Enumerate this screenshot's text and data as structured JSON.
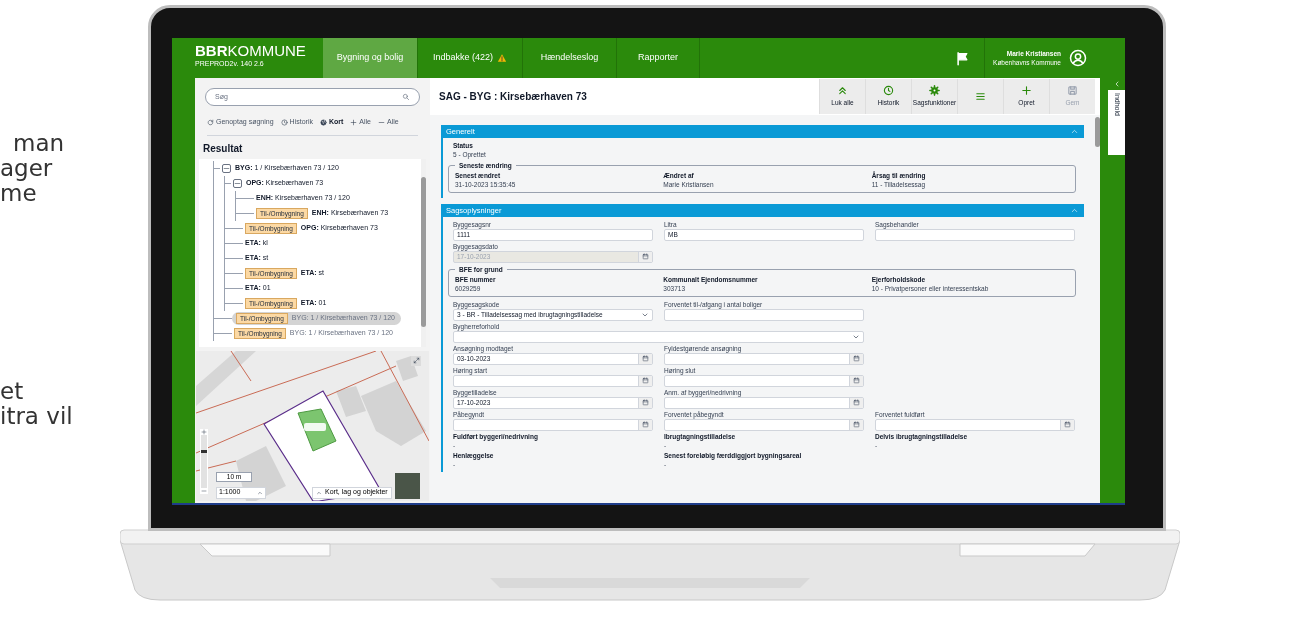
{
  "background_text": [
    "man",
    "ager",
    "me",
    "et",
    "itra vil"
  ],
  "header": {
    "logo_bold": "BBR",
    "logo_light": "KOMMUNE",
    "version": "PREPROD2v. 140 2.6",
    "tabs": [
      {
        "label": "Bygning og bolig",
        "selected": true,
        "warning": false
      },
      {
        "label": "Indbakke (422)",
        "selected": false,
        "warning": true
      },
      {
        "label": "Hændelseslog",
        "selected": false,
        "warning": false
      },
      {
        "label": "Rapporter",
        "selected": false,
        "warning": false
      }
    ],
    "user": {
      "name": "Marie Kristiansen",
      "org": "Københavns Kommune"
    }
  },
  "search": {
    "placeholder": "Søg"
  },
  "search_tools": [
    {
      "label": "Genoptag søgning",
      "kind": "refresh",
      "selected": false
    },
    {
      "label": "Historik",
      "kind": "clock",
      "selected": false
    },
    {
      "label": "Kort",
      "kind": "globe",
      "selected": true
    },
    {
      "label": "Alle",
      "kind": "plus",
      "selected": false
    },
    {
      "label": "Alle",
      "kind": "minus",
      "selected": false
    }
  ],
  "results": {
    "title": "Resultat",
    "tree": [
      {
        "text": "**BYG:** 1 / Kirsebærhaven 73 / 120",
        "expanded": true,
        "selected": false,
        "inactive": false,
        "children": [
          {
            "text": "**OPG:** Kirsebærhaven 73",
            "expanded": true,
            "selected": false,
            "inactive": false,
            "children": [
              {
                "text": "**ENH:** Kirsebærhaven 73 / 120",
                "selected": false,
                "inactive": false
              },
              {
                "badge": "Til-/Ombygning",
                "text": "**ENH:** Kirsebærhaven 73",
                "selected": false,
                "inactive": false
              }
            ]
          },
          {
            "badge": "Til-/Ombygning",
            "text": "**OPG:** Kirsebærhaven 73",
            "selected": false,
            "inactive": false
          },
          {
            "text": "**ETA:** kl",
            "selected": false,
            "inactive": false
          },
          {
            "text": "**ETA:** st",
            "selected": false,
            "inactive": false
          },
          {
            "badge": "Til-/Ombygning",
            "text": "**ETA:** st",
            "selected": false,
            "inactive": false
          },
          {
            "text": "**ETA:** 01",
            "selected": false,
            "inactive": false
          },
          {
            "badge": "Til-/Ombygning",
            "text": "**ETA:** 01",
            "selected": false,
            "inactive": false
          }
        ]
      },
      {
        "badge": "Til-/Ombygning",
        "text": "BYG: 1 / Kirsebærhaven 73 / 120",
        "selected": true,
        "inactive": true
      },
      {
        "badge": "Til-/Ombygning",
        "text": "BYG: 1 / Kirsebærhaven 73 / 120",
        "selected": false,
        "inactive": true
      }
    ]
  },
  "map": {
    "zoom": {
      "level": 0.65
    },
    "scale_bar": "10 m",
    "scale": "1:1000",
    "layers_button": "Kort, lag og objekter"
  },
  "case": {
    "title": "SAG - BYG : Kirsebærhaven 73",
    "toolbar": [
      {
        "label": "Luk alle",
        "kind": "chevrons-up",
        "disabled": false
      },
      {
        "label": "Historik",
        "kind": "clock",
        "disabled": false
      },
      {
        "label": "Sagsfunktioner",
        "kind": "gear",
        "disabled": false
      },
      {
        "kind": "menu",
        "disabled": false
      },
      {
        "label": "Opret",
        "kind": "plus",
        "disabled": false
      },
      {
        "label": "Gem",
        "kind": "save",
        "disabled": true
      }
    ]
  },
  "sections": [
    {
      "title": "Generelt",
      "expanded": true,
      "rows": [
        [
          {
            "kind": "readonly",
            "label": "Status",
            "value": "5 - Oprettet"
          }
        ],
        [
          {
            "kind": "group",
            "title": "Seneste ændring",
            "items": [
              {
                "label": "Senest ændret",
                "value": "31-10-2023 15:35:45"
              },
              {
                "label": "Ændret af",
                "value": "Marie Kristiansen"
              },
              {
                "label": "Årsag til ændring",
                "value": "11 - Tilladelsessag"
              }
            ]
          }
        ]
      ]
    },
    {
      "title": "Sagsoplysninger",
      "expanded": true,
      "rows": [
        [
          {
            "kind": "text",
            "label": "Byggesagsnr",
            "value": "1111",
            "disabled": false
          },
          {
            "kind": "text",
            "label": "Litra",
            "value": "MB",
            "disabled": false
          },
          {
            "kind": "text",
            "label": "Sagsbehandler",
            "disabled": false
          }
        ],
        [
          {
            "kind": "date",
            "label": "Byggesagsdato",
            "value": "17-10-2023",
            "disabled": true
          }
        ],
        [
          {
            "kind": "group",
            "title": "BFE for grund",
            "items": [
              {
                "label": "BFE nummer",
                "value": "6029259"
              },
              {
                "label": "Kommunalt Ejendomsnummer",
                "value": "303713"
              },
              {
                "label": "Ejerforholdskode",
                "value": "10 - Privatpersoner eller interessentskab"
              }
            ]
          }
        ],
        [
          {
            "kind": "select",
            "label": "Byggesagskode",
            "value": "3 - BR - Tilladelsessag med ibrugtagningstilladelse",
            "disabled": false
          },
          {
            "kind": "text",
            "label": "Forventet til-/afgang i antal boliger",
            "disabled": false
          }
        ],
        [
          {
            "kind": "select",
            "label": "Bygherreforhold",
            "wide": true,
            "disabled": false
          }
        ],
        [
          {
            "kind": "date",
            "label": "Ansøgning modtaget",
            "value": "03-10-2023",
            "disabled": false
          },
          {
            "kind": "date",
            "label": "Fyldestgørende ansøgning",
            "disabled": false
          }
        ],
        [
          {
            "kind": "date",
            "label": "Høring start",
            "disabled": false
          },
          {
            "kind": "date",
            "label": "Høring slut",
            "disabled": false
          }
        ],
        [
          {
            "kind": "date",
            "label": "Byggetilladelse",
            "value": "17-10-2023",
            "disabled": false
          },
          {
            "kind": "date",
            "label": "Anm. af byggeri/nedrivning",
            "disabled": false
          }
        ],
        [
          {
            "kind": "date",
            "label": "Påbegyndt",
            "disabled": false
          },
          {
            "kind": "date",
            "label": "Forventet påbegyndt",
            "disabled": false
          },
          {
            "kind": "date",
            "label": "Forventet fuldført",
            "disabled": false
          }
        ],
        [
          {
            "kind": "readonly",
            "label": "Fuldført byggeri/nedrivning",
            "value": "-"
          },
          {
            "kind": "readonly",
            "label": "Ibrugtagningstilladelse",
            "value": "-"
          },
          {
            "kind": "readonly",
            "label": "Delvis ibrugtagningstilladelse",
            "value": "-"
          }
        ],
        [
          {
            "kind": "readonly",
            "label": "Henlæggelse",
            "value": "-"
          },
          {
            "kind": "readonly",
            "label": "Senest foreløbig færddiggjort bygningsareal",
            "value": "-"
          }
        ]
      ]
    }
  ],
  "side_tab": {
    "label": "Indhold"
  }
}
